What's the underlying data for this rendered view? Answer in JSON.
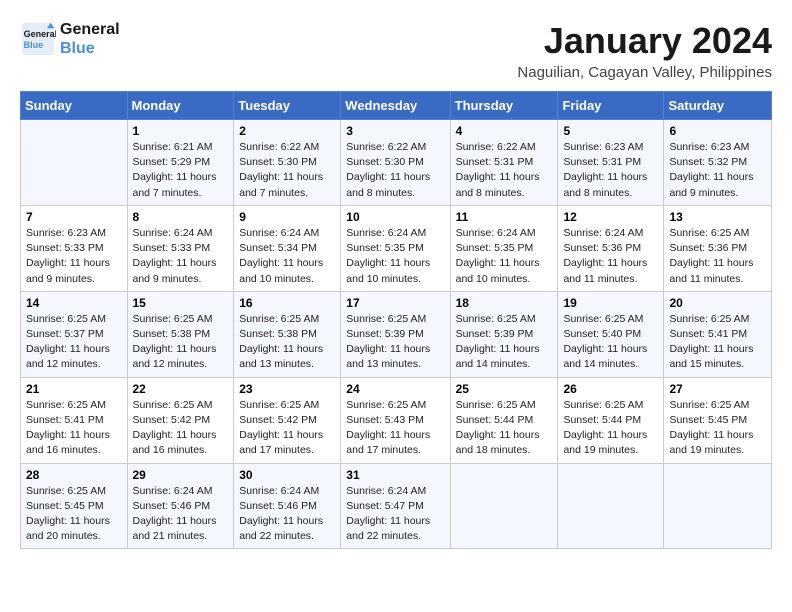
{
  "header": {
    "logo_line1": "General",
    "logo_line2": "Blue",
    "month": "January 2024",
    "location": "Naguilian, Cagayan Valley, Philippines"
  },
  "weekdays": [
    "Sunday",
    "Monday",
    "Tuesday",
    "Wednesday",
    "Thursday",
    "Friday",
    "Saturday"
  ],
  "weeks": [
    [
      {
        "day": "",
        "info": ""
      },
      {
        "day": "1",
        "info": "Sunrise: 6:21 AM\nSunset: 5:29 PM\nDaylight: 11 hours\nand 7 minutes."
      },
      {
        "day": "2",
        "info": "Sunrise: 6:22 AM\nSunset: 5:30 PM\nDaylight: 11 hours\nand 7 minutes."
      },
      {
        "day": "3",
        "info": "Sunrise: 6:22 AM\nSunset: 5:30 PM\nDaylight: 11 hours\nand 8 minutes."
      },
      {
        "day": "4",
        "info": "Sunrise: 6:22 AM\nSunset: 5:31 PM\nDaylight: 11 hours\nand 8 minutes."
      },
      {
        "day": "5",
        "info": "Sunrise: 6:23 AM\nSunset: 5:31 PM\nDaylight: 11 hours\nand 8 minutes."
      },
      {
        "day": "6",
        "info": "Sunrise: 6:23 AM\nSunset: 5:32 PM\nDaylight: 11 hours\nand 9 minutes."
      }
    ],
    [
      {
        "day": "7",
        "info": "Sunrise: 6:23 AM\nSunset: 5:33 PM\nDaylight: 11 hours\nand 9 minutes."
      },
      {
        "day": "8",
        "info": "Sunrise: 6:24 AM\nSunset: 5:33 PM\nDaylight: 11 hours\nand 9 minutes."
      },
      {
        "day": "9",
        "info": "Sunrise: 6:24 AM\nSunset: 5:34 PM\nDaylight: 11 hours\nand 10 minutes."
      },
      {
        "day": "10",
        "info": "Sunrise: 6:24 AM\nSunset: 5:35 PM\nDaylight: 11 hours\nand 10 minutes."
      },
      {
        "day": "11",
        "info": "Sunrise: 6:24 AM\nSunset: 5:35 PM\nDaylight: 11 hours\nand 10 minutes."
      },
      {
        "day": "12",
        "info": "Sunrise: 6:24 AM\nSunset: 5:36 PM\nDaylight: 11 hours\nand 11 minutes."
      },
      {
        "day": "13",
        "info": "Sunrise: 6:25 AM\nSunset: 5:36 PM\nDaylight: 11 hours\nand 11 minutes."
      }
    ],
    [
      {
        "day": "14",
        "info": "Sunrise: 6:25 AM\nSunset: 5:37 PM\nDaylight: 11 hours\nand 12 minutes."
      },
      {
        "day": "15",
        "info": "Sunrise: 6:25 AM\nSunset: 5:38 PM\nDaylight: 11 hours\nand 12 minutes."
      },
      {
        "day": "16",
        "info": "Sunrise: 6:25 AM\nSunset: 5:38 PM\nDaylight: 11 hours\nand 13 minutes."
      },
      {
        "day": "17",
        "info": "Sunrise: 6:25 AM\nSunset: 5:39 PM\nDaylight: 11 hours\nand 13 minutes."
      },
      {
        "day": "18",
        "info": "Sunrise: 6:25 AM\nSunset: 5:39 PM\nDaylight: 11 hours\nand 14 minutes."
      },
      {
        "day": "19",
        "info": "Sunrise: 6:25 AM\nSunset: 5:40 PM\nDaylight: 11 hours\nand 14 minutes."
      },
      {
        "day": "20",
        "info": "Sunrise: 6:25 AM\nSunset: 5:41 PM\nDaylight: 11 hours\nand 15 minutes."
      }
    ],
    [
      {
        "day": "21",
        "info": "Sunrise: 6:25 AM\nSunset: 5:41 PM\nDaylight: 11 hours\nand 16 minutes."
      },
      {
        "day": "22",
        "info": "Sunrise: 6:25 AM\nSunset: 5:42 PM\nDaylight: 11 hours\nand 16 minutes."
      },
      {
        "day": "23",
        "info": "Sunrise: 6:25 AM\nSunset: 5:42 PM\nDaylight: 11 hours\nand 17 minutes."
      },
      {
        "day": "24",
        "info": "Sunrise: 6:25 AM\nSunset: 5:43 PM\nDaylight: 11 hours\nand 17 minutes."
      },
      {
        "day": "25",
        "info": "Sunrise: 6:25 AM\nSunset: 5:44 PM\nDaylight: 11 hours\nand 18 minutes."
      },
      {
        "day": "26",
        "info": "Sunrise: 6:25 AM\nSunset: 5:44 PM\nDaylight: 11 hours\nand 19 minutes."
      },
      {
        "day": "27",
        "info": "Sunrise: 6:25 AM\nSunset: 5:45 PM\nDaylight: 11 hours\nand 19 minutes."
      }
    ],
    [
      {
        "day": "28",
        "info": "Sunrise: 6:25 AM\nSunset: 5:45 PM\nDaylight: 11 hours\nand 20 minutes."
      },
      {
        "day": "29",
        "info": "Sunrise: 6:24 AM\nSunset: 5:46 PM\nDaylight: 11 hours\nand 21 minutes."
      },
      {
        "day": "30",
        "info": "Sunrise: 6:24 AM\nSunset: 5:46 PM\nDaylight: 11 hours\nand 22 minutes."
      },
      {
        "day": "31",
        "info": "Sunrise: 6:24 AM\nSunset: 5:47 PM\nDaylight: 11 hours\nand 22 minutes."
      },
      {
        "day": "",
        "info": ""
      },
      {
        "day": "",
        "info": ""
      },
      {
        "day": "",
        "info": ""
      }
    ]
  ]
}
